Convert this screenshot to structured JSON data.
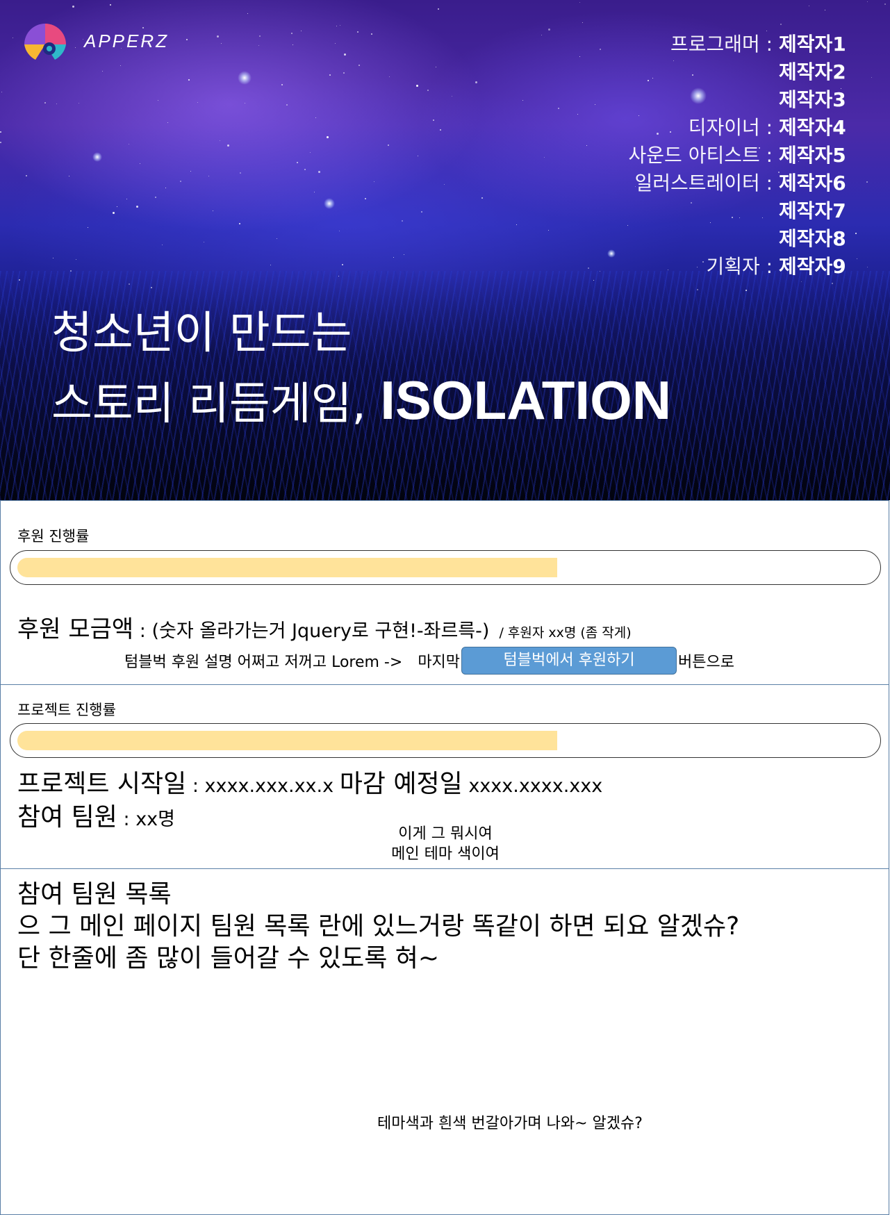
{
  "brand": {
    "name": "APPERZ"
  },
  "credits": [
    {
      "role": "프로그래머 :",
      "name": "제작자1"
    },
    {
      "role": "",
      "name": "제작자2"
    },
    {
      "role": "",
      "name": "제작자3"
    },
    {
      "role": "디자이너 :",
      "name": "제작자4"
    },
    {
      "role": "사운드 아티스트 :",
      "name": "제작자5"
    },
    {
      "role": "일러스트레이터 :",
      "name": "제작자6"
    },
    {
      "role": "",
      "name": "제작자7"
    },
    {
      "role": "",
      "name": "제작자8"
    },
    {
      "role": "기획자 :",
      "name": "제작자9"
    }
  ],
  "hero": {
    "line1": "청소년이 만드는",
    "line2_prefix": "스토리 리듬게임, ",
    "line2_strong": "ISOLATION"
  },
  "donation": {
    "label": "후원 진행률",
    "progress": 0.63,
    "amount_label": "후원 모금액",
    "amount_value": " : (숫자 올라가는거 Jquery로 구현!-좌르륵-)",
    "backers_note": "/ 후원자 xx명 (좀 작게)",
    "desc_text": "텀블벅 후원 설명 어쩌고 저꺼고 Lorem ->",
    "desc_last": "마지막",
    "cta_label": "텀블벅에서 후원하기",
    "desc_after": "버튼으로"
  },
  "project": {
    "label": "프로젝트 진행률",
    "progress": 0.63,
    "start_label": "프로젝트 시작일",
    "start_value": " : xxxx.xxx.xx.x ",
    "end_label": "마감 예정일",
    "end_value": " xxxx.xxxx.xxx",
    "members_label": "참여 팀원",
    "members_value": " : xx명",
    "note_line1": "이게 그 뭐시여",
    "note_line2": "메인 테마 색이여"
  },
  "members": {
    "line1": "참여 팀원 목록",
    "line2": "으 그 메인 페이지 팀원 목록 란에 있느거랑 똑같이 하면 되요 알겠슈?",
    "line3": "단 한줄에 좀 많이 들어갈 수 있도록 혀~",
    "alt_note": "테마색과 흰색 번갈아가며 나와~ 알겠슈?"
  },
  "colors": {
    "progress_fill": "#ffe39a",
    "cta_button": "#5b9bd5",
    "section_border": "#5a7fa6"
  }
}
